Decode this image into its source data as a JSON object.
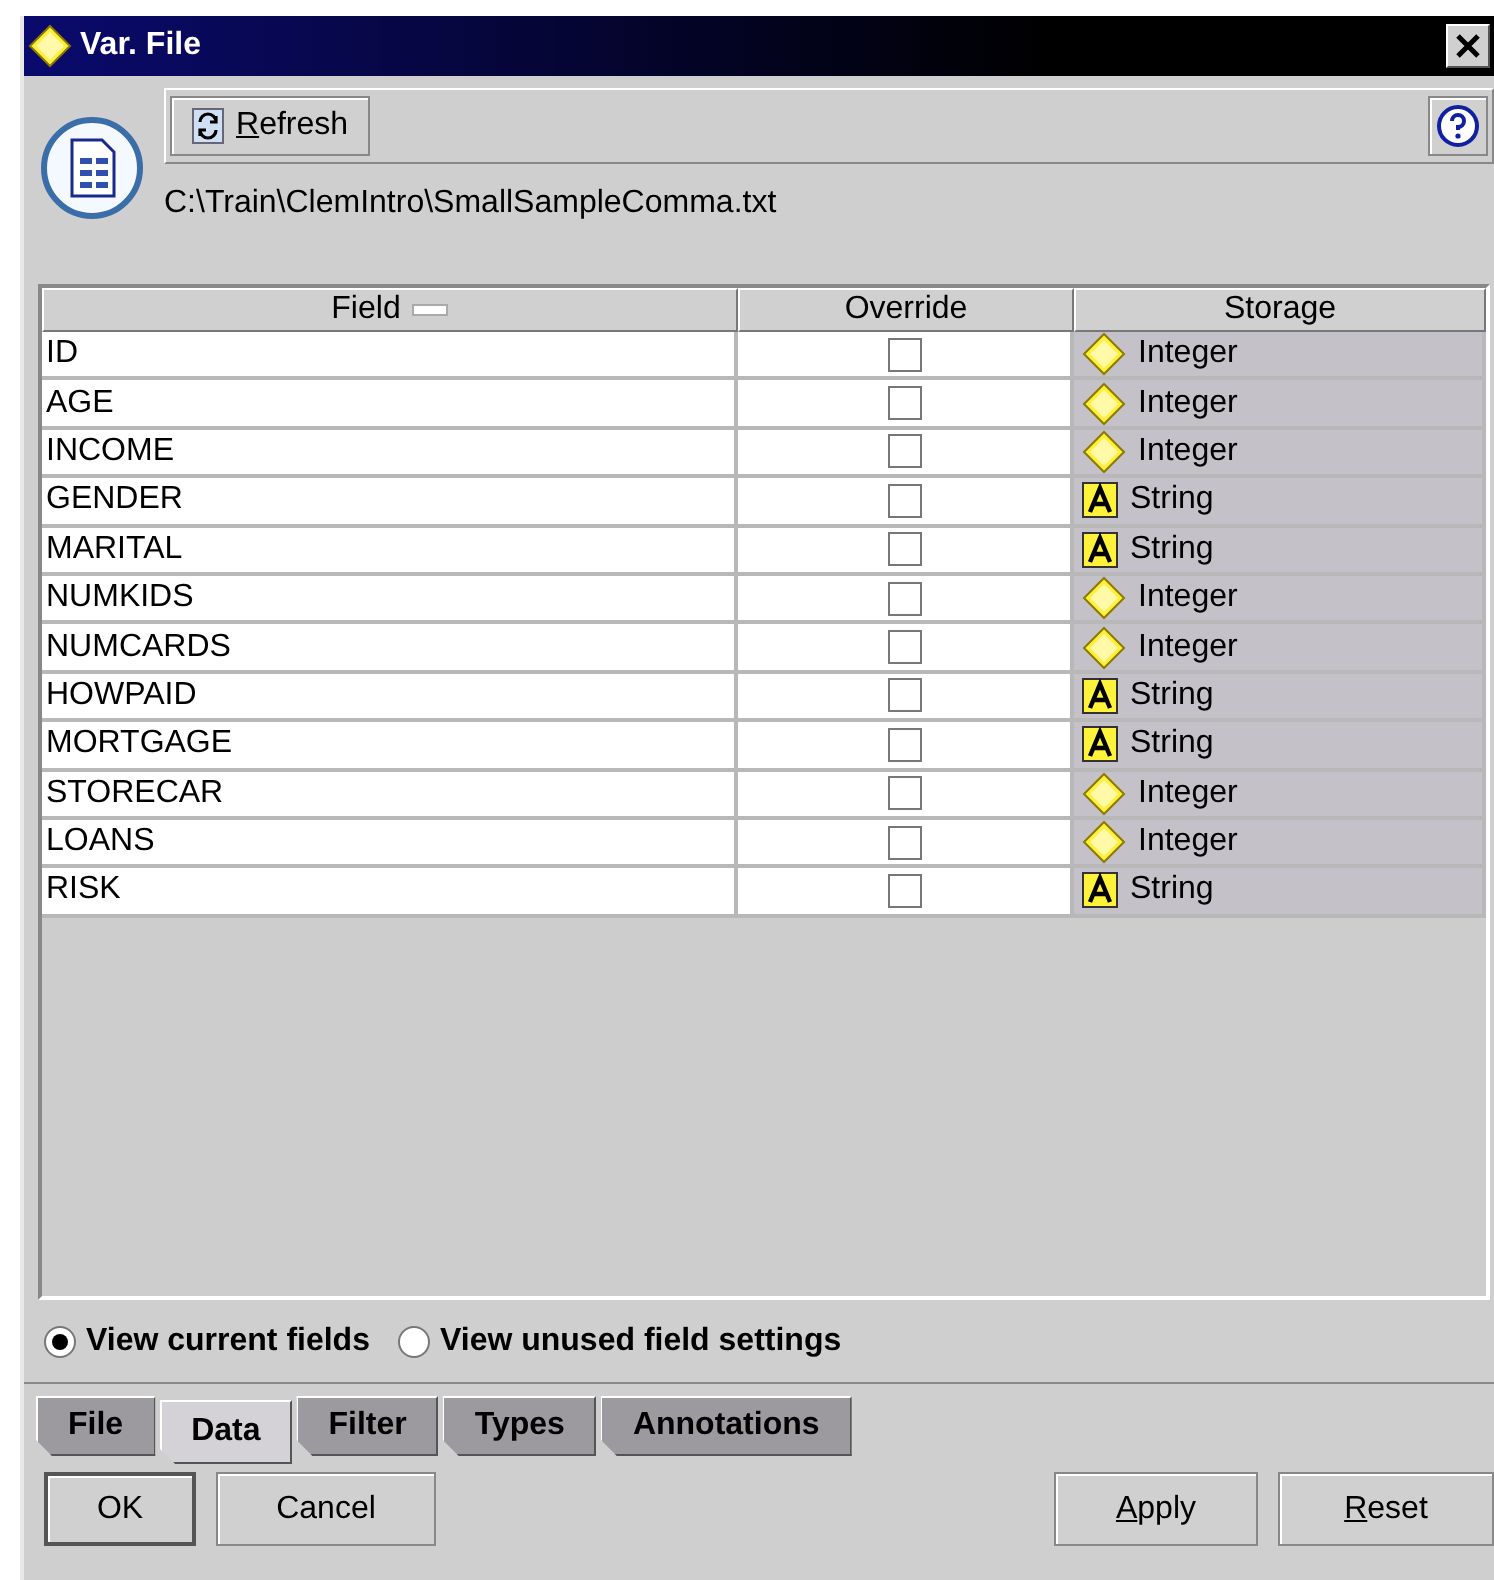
{
  "window": {
    "title": "Var. File"
  },
  "toolbar": {
    "refresh": {
      "label": "Refresh",
      "underline_first": true
    }
  },
  "path": "C:\\Train\\ClemIntro\\SmallSampleComma.txt",
  "table": {
    "columns": [
      "Field",
      "Override",
      "Storage"
    ],
    "rows": [
      {
        "field": "ID",
        "override": false,
        "storage": "Integer",
        "kind": "integer"
      },
      {
        "field": "AGE",
        "override": false,
        "storage": "Integer",
        "kind": "integer"
      },
      {
        "field": "INCOME",
        "override": false,
        "storage": "Integer",
        "kind": "integer"
      },
      {
        "field": "GENDER",
        "override": false,
        "storage": "String",
        "kind": "string"
      },
      {
        "field": "MARITAL",
        "override": false,
        "storage": "String",
        "kind": "string"
      },
      {
        "field": "NUMKIDS",
        "override": false,
        "storage": "Integer",
        "kind": "integer"
      },
      {
        "field": "NUMCARDS",
        "override": false,
        "storage": "Integer",
        "kind": "integer"
      },
      {
        "field": "HOWPAID",
        "override": false,
        "storage": "String",
        "kind": "string"
      },
      {
        "field": "MORTGAGE",
        "override": false,
        "storage": "String",
        "kind": "string"
      },
      {
        "field": "STORECAR",
        "override": false,
        "storage": "Integer",
        "kind": "integer"
      },
      {
        "field": "LOANS",
        "override": false,
        "storage": "Integer",
        "kind": "integer"
      },
      {
        "field": "RISK",
        "override": false,
        "storage": "String",
        "kind": "string"
      }
    ]
  },
  "view_options": [
    {
      "label": "View current fields",
      "selected": true
    },
    {
      "label": "View unused field settings",
      "selected": false
    }
  ],
  "tabs": [
    {
      "label": "File",
      "selected": false
    },
    {
      "label": "Data",
      "selected": true
    },
    {
      "label": "Filter",
      "selected": false
    },
    {
      "label": "Types",
      "selected": false
    },
    {
      "label": "Annotations",
      "selected": false
    }
  ],
  "buttons_left": [
    {
      "label": "OK",
      "default": true,
      "underline_first": false
    },
    {
      "label": "Cancel",
      "default": false,
      "underline_first": false
    }
  ],
  "buttons_right": [
    {
      "label": "Apply",
      "default": false,
      "underline_first": true
    },
    {
      "label": "Reset",
      "default": false,
      "underline_first": true
    }
  ]
}
